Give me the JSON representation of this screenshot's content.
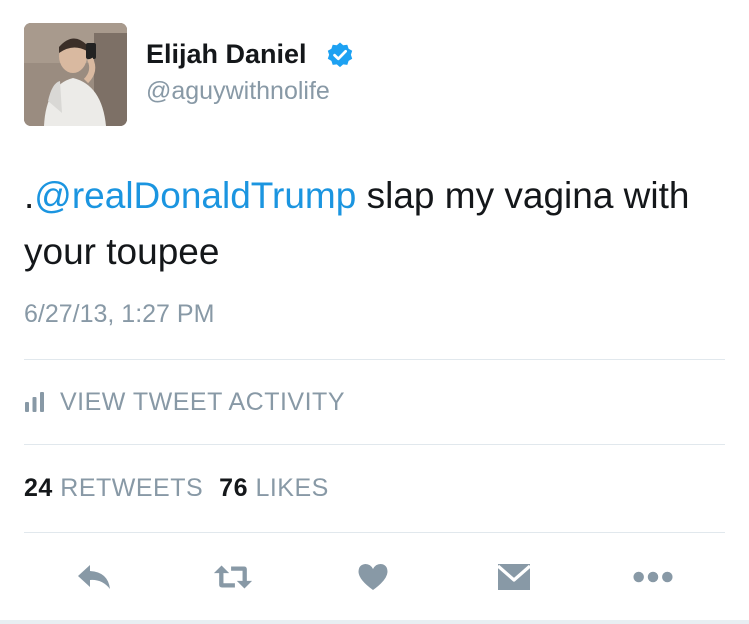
{
  "user": {
    "display_name": "Elijah Daniel",
    "handle": "@aguywithnolife",
    "verified": true
  },
  "tweet": {
    "prefix": ".",
    "mention": "@realDonaldTrump",
    "text": " slap my vagina with your toupee",
    "timestamp": "6/27/13, 1:27 PM"
  },
  "activity": {
    "label": "VIEW TWEET ACTIVITY",
    "icon": "bar-chart-icon"
  },
  "stats": {
    "retweets_count": "24",
    "retweets_label": "RETWEETS",
    "likes_count": "76",
    "likes_label": "LIKES"
  },
  "actions": {
    "reply_icon": "reply-icon",
    "retweet_icon": "retweet-icon",
    "like_icon": "heart-icon",
    "dm_icon": "envelope-icon",
    "more_icon": "more-dots-icon"
  },
  "colors": {
    "mention": "#1b95e0",
    "verified": "#1da1f2",
    "muted": "#8899a6",
    "text": "#14171a",
    "icon": "#8899a6",
    "divider": "#e1e8ed"
  }
}
